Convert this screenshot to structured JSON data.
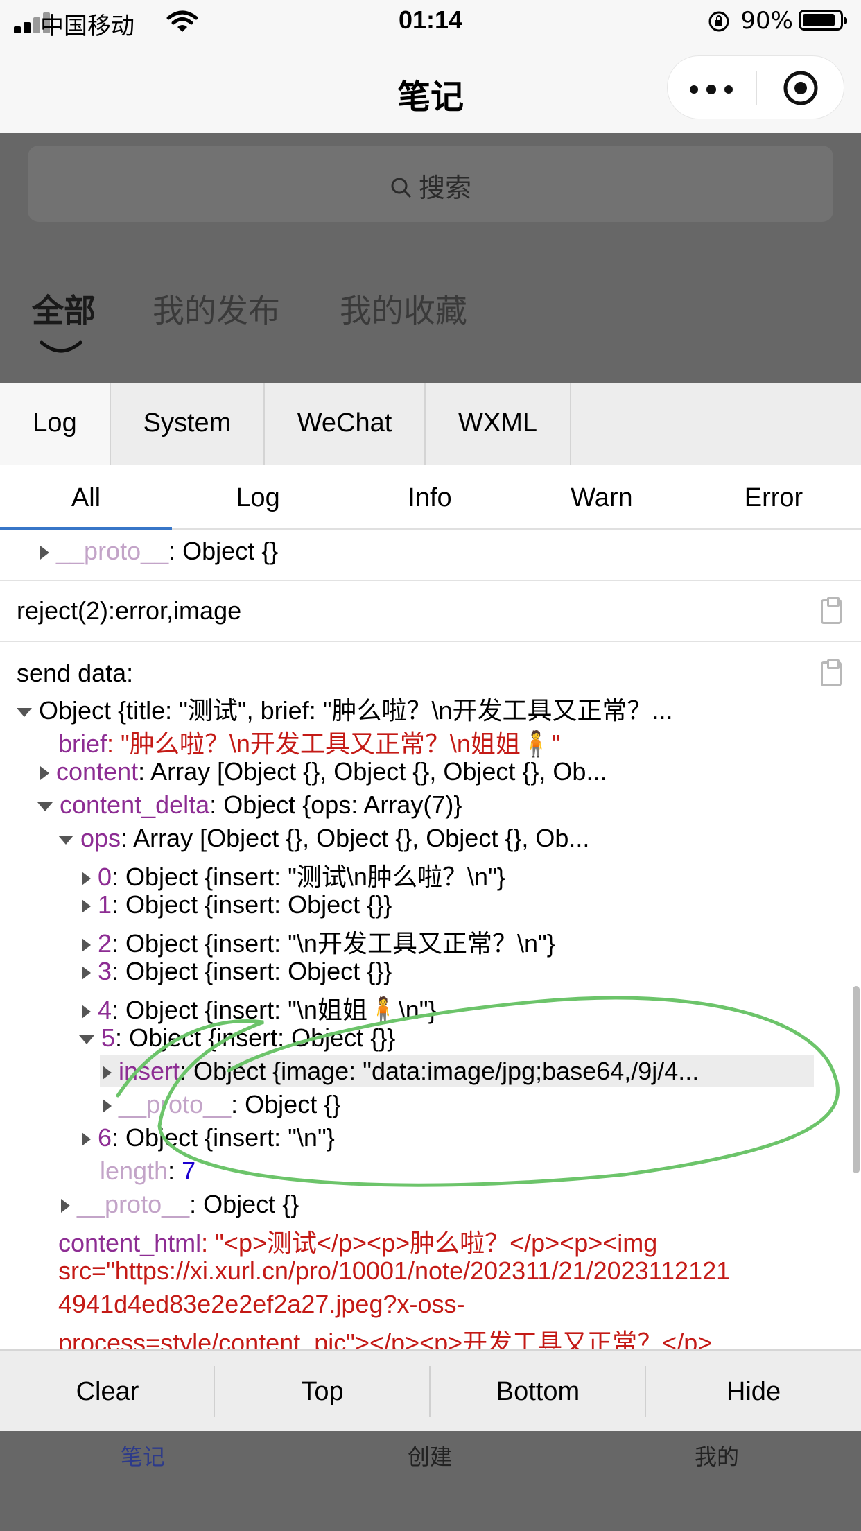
{
  "status_bar": {
    "carrier": "中国移动",
    "time": "01:14",
    "battery": "90%"
  },
  "nav": {
    "title": "笔记"
  },
  "page": {
    "search_placeholder": "搜索",
    "tabs": [
      "全部",
      "我的发布",
      "我的收藏"
    ]
  },
  "vconsole": {
    "tabs": [
      "Log",
      "System",
      "WeChat",
      "WXML"
    ],
    "subtabs": [
      "All",
      "Log",
      "Info",
      "Warn",
      "Error"
    ],
    "lines": {
      "proto1_key": "__proto__",
      "proto1_val": ": Object {}",
      "reject": "reject(2):error,image",
      "send": "send data:",
      "obj_head": "Object {title: \"测试\", brief: \"肿么啦？\\n开发工具又正常？...",
      "brief_key": "brief",
      "brief_val": "\"肿么啦？\\n开发工具又正常？\\n姐姐🧍\"",
      "content_key": "content",
      "content_val": ": Array [Object {}, Object {}, Object {}, Ob...",
      "delta_key": "content_delta",
      "delta_val": ": Object {ops: Array(7)}",
      "ops_key": "ops",
      "ops_val": ": Array [Object {}, Object {}, Object {}, Ob...",
      "op0_key": "0",
      "op0_val": ": Object {insert: \"测试\\n肿么啦？\\n\"}",
      "op1_key": "1",
      "op1_val": ": Object {insert: Object {}}",
      "op2_key": "2",
      "op2_val": ": Object {insert: \"\\n开发工具又正常？\\n\"}",
      "op3_key": "3",
      "op3_val": ": Object {insert: Object {}}",
      "op4_key": "4",
      "op4_val": ": Object {insert: \"\\n姐姐🧍\\n\"}",
      "op5_key": "5",
      "op5_val": ": Object {insert: Object {}}",
      "insert_key": "insert",
      "insert_val": ": Object {image: \"data:image/jpg;base64,/9j/4...",
      "proto2_key": "__proto__",
      "proto2_val": ": Object {}",
      "op6_key": "6",
      "op6_val": ": Object {insert: \"\\n\"}",
      "length_key": "length",
      "length_sep": ": ",
      "length_val": "7",
      "proto3_key": "__proto__",
      "proto3_val": ": Object {}",
      "html_key": "content_html",
      "html_sep": ": ",
      "html_l1": "\"<p>测试</p><p>肿么啦？</p><p><img",
      "html_l2": "src=\"https://xi.xurl.cn/pro/10001/note/202311/21/2023112121",
      "html_l3": "4941d4ed83e2e2ef2a27.jpeg?x-oss-",
      "html_l4": "process=style/content_pic\"></p><p>开发工具又正常？</p>"
    },
    "footer_buttons": [
      "Clear",
      "Top",
      "Bottom",
      "Hide"
    ]
  },
  "tab_bar": [
    "笔记",
    "创建",
    "我的"
  ],
  "colors": {
    "key": "#8d2d93",
    "string": "#c41a16",
    "number": "#1c00cf",
    "annotation": "#6cc46a",
    "link": "#3876c8"
  }
}
